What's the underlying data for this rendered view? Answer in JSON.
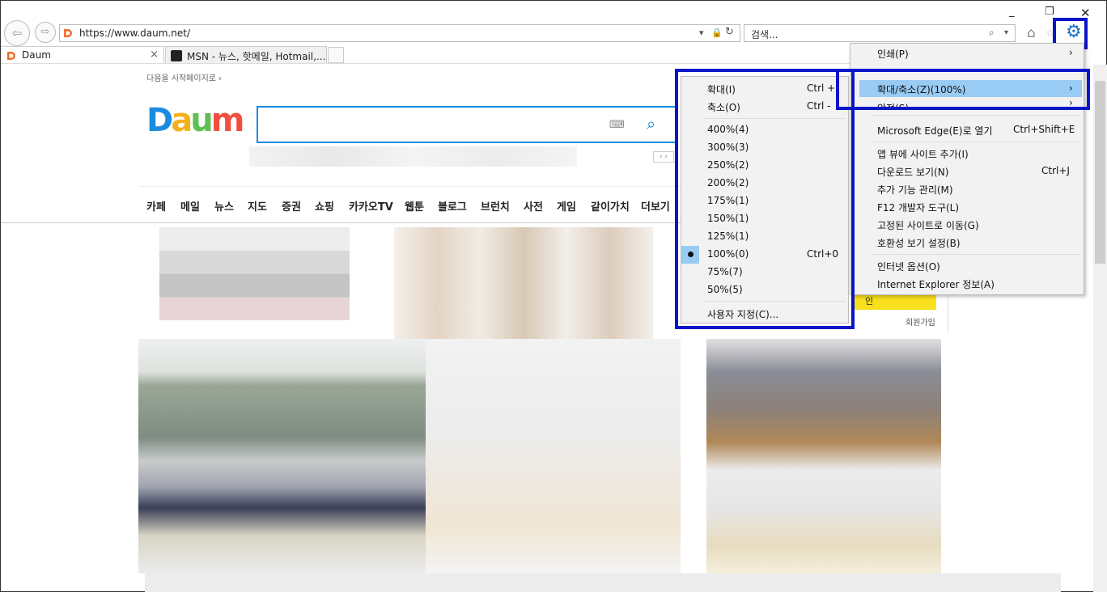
{
  "browser": {
    "address_url": "https://www.daum.net/",
    "search_placeholder": "검색...",
    "tabs": [
      {
        "label": "Daum"
      },
      {
        "label": "MSN - 뉴스, 핫메일, Hotmail,..."
      }
    ],
    "close_glyph": "×"
  },
  "page": {
    "start_page_link": "다음을 시작페이지로 ›",
    "logo_text": "Daum",
    "nav_items": [
      "카페",
      "메일",
      "뉴스",
      "지도",
      "증권",
      "쇼핑",
      "카카오TV",
      "웹툰",
      "블로그",
      "브런치",
      "사전",
      "게임",
      "같이가치",
      "더보기"
    ],
    "signup": "회원가입",
    "partial_text": "인"
  },
  "tools_menu": {
    "items": [
      {
        "label": "인쇄(P)",
        "shortcut": "›"
      },
      {
        "label": "확대/축소(Z)(100%)",
        "shortcut": "›"
      },
      {
        "label": "안전(S)",
        "shortcut": "›"
      },
      {
        "label": "Microsoft Edge(E)로 열기",
        "shortcut": "Ctrl+Shift+E"
      },
      {
        "label": "앱 뷰에 사이트 추가(I)",
        "shortcut": ""
      },
      {
        "label": "다운로드 보기(N)",
        "shortcut": "Ctrl+J"
      },
      {
        "label": "추가 기능 관리(M)",
        "shortcut": ""
      },
      {
        "label": "F12 개발자 도구(L)",
        "shortcut": ""
      },
      {
        "label": "고정된 사이트로 이동(G)",
        "shortcut": ""
      },
      {
        "label": "호환성 보기 설정(B)",
        "shortcut": ""
      },
      {
        "label": "인터넷 옵션(O)",
        "shortcut": ""
      },
      {
        "label": "Internet Explorer 정보(A)",
        "shortcut": ""
      }
    ]
  },
  "zoom_menu": {
    "items": [
      {
        "label": "확대(I)",
        "shortcut": "Ctrl +"
      },
      {
        "label": "축소(O)",
        "shortcut": "Ctrl -"
      },
      {
        "label": "400%(4)",
        "shortcut": ""
      },
      {
        "label": "300%(3)",
        "shortcut": ""
      },
      {
        "label": "250%(2)",
        "shortcut": ""
      },
      {
        "label": "200%(2)",
        "shortcut": ""
      },
      {
        "label": "175%(1)",
        "shortcut": ""
      },
      {
        "label": "150%(1)",
        "shortcut": ""
      },
      {
        "label": "125%(1)",
        "shortcut": ""
      },
      {
        "label": "100%(0)",
        "shortcut": "Ctrl+0"
      },
      {
        "label": "75%(7)",
        "shortcut": ""
      },
      {
        "label": "50%(5)",
        "shortcut": ""
      },
      {
        "label": "사용자 지정(C)...",
        "shortcut": ""
      }
    ],
    "selected": "100%(0)"
  },
  "colors": {
    "highlight_frame": "#0a14c8",
    "menu_hover": "#99ccf5",
    "daum_blue": "#1a8ce0"
  }
}
